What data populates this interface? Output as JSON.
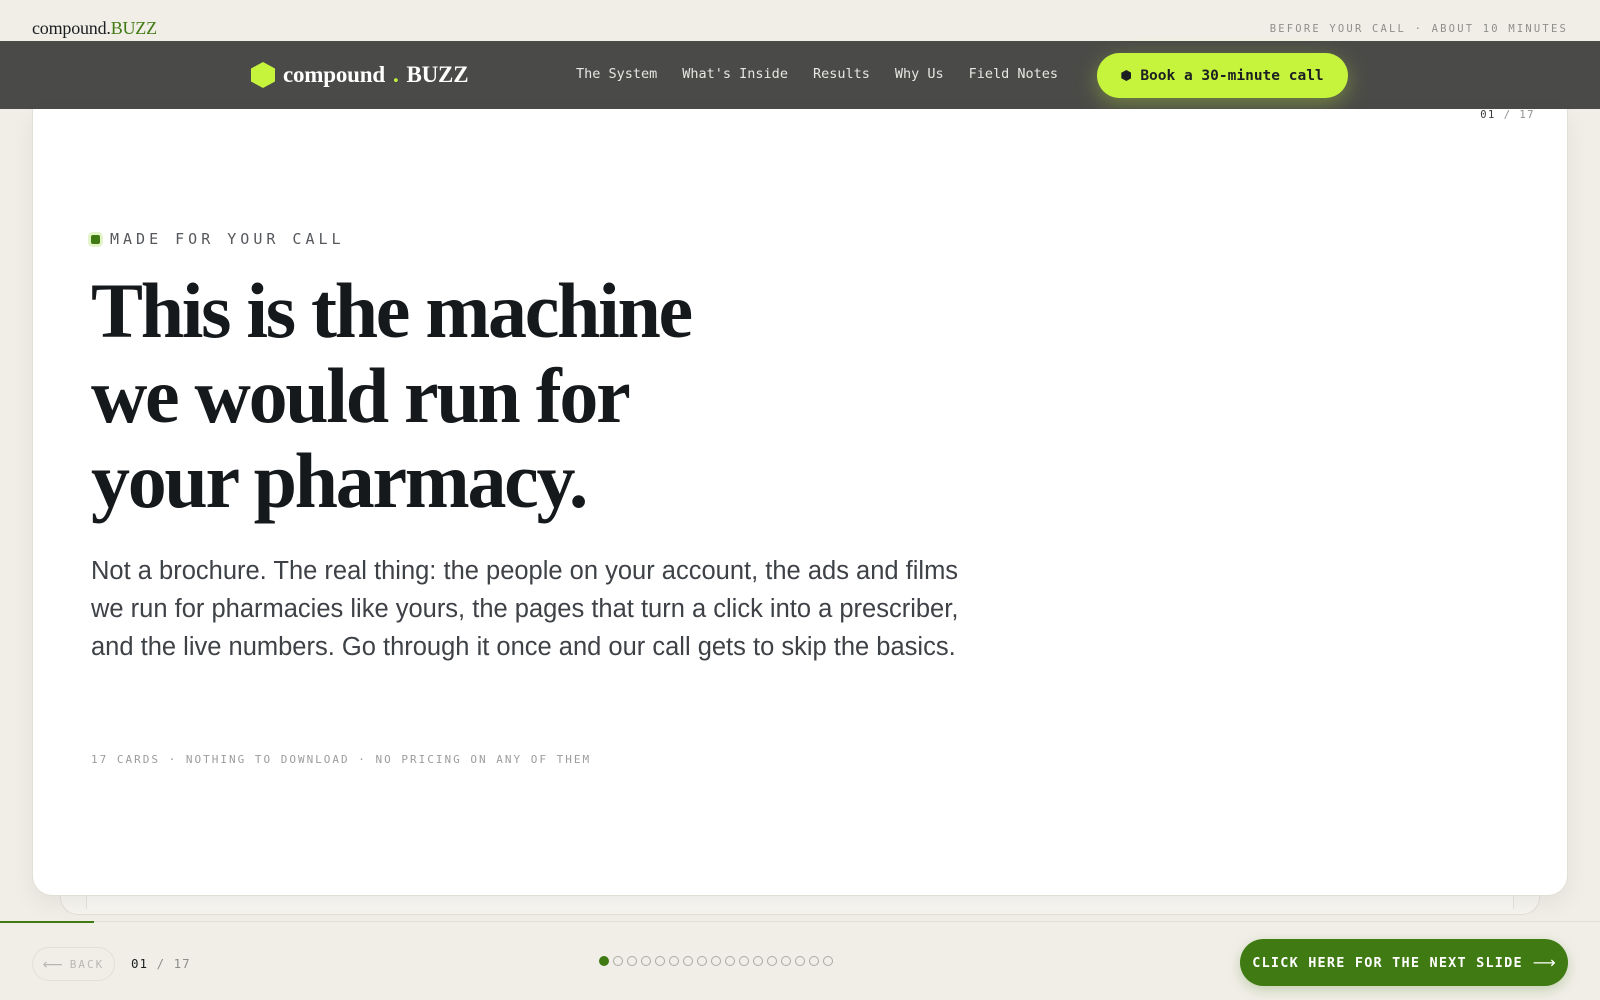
{
  "top_strip": {
    "brand_main": "compound.",
    "brand_accent": "BUZZ",
    "meta": "BEFORE YOUR CALL · ABOUT 10 MINUTES"
  },
  "navbar": {
    "logo_main": "compound",
    "logo_dot": ".",
    "logo_accent": "BUZZ",
    "links": [
      {
        "label": "The System"
      },
      {
        "label": "What's Inside"
      },
      {
        "label": "Results"
      },
      {
        "label": "Why Us"
      },
      {
        "label": "Field Notes"
      }
    ],
    "cta_label": "Book a 30-minute call"
  },
  "slide": {
    "current": "01",
    "separator": "/",
    "total": "17",
    "eyebrow": "MADE FOR YOUR CALL",
    "headline_lines": [
      "This is the machine",
      "we would run for",
      "your pharmacy."
    ],
    "subhead": "Not a brochure. The real thing: the people on your account, the ads and films we run for pharmacies like yours, the pages that turn a click into a prescriber, and the live numbers. Go through it once and our call gets to skip the basics.",
    "footnote": "17 CARDS · NOTHING TO DOWNLOAD · NO PRICING ON ANY OF THEM"
  },
  "bottom_bar": {
    "back_icon": "arrow-left-icon",
    "back_label": "BACK",
    "progress": 0.0588,
    "dots_total": 17,
    "dots_active_index": 0,
    "next_label": "CLICK HERE FOR THE NEXT SLIDE",
    "next_icon": "arrow-right-icon"
  },
  "colors": {
    "accent_lime": "#c6f33c",
    "accent_green": "#3f7a12",
    "nav_bg": "#4a4a48",
    "page_bg": "#f1eee7"
  }
}
